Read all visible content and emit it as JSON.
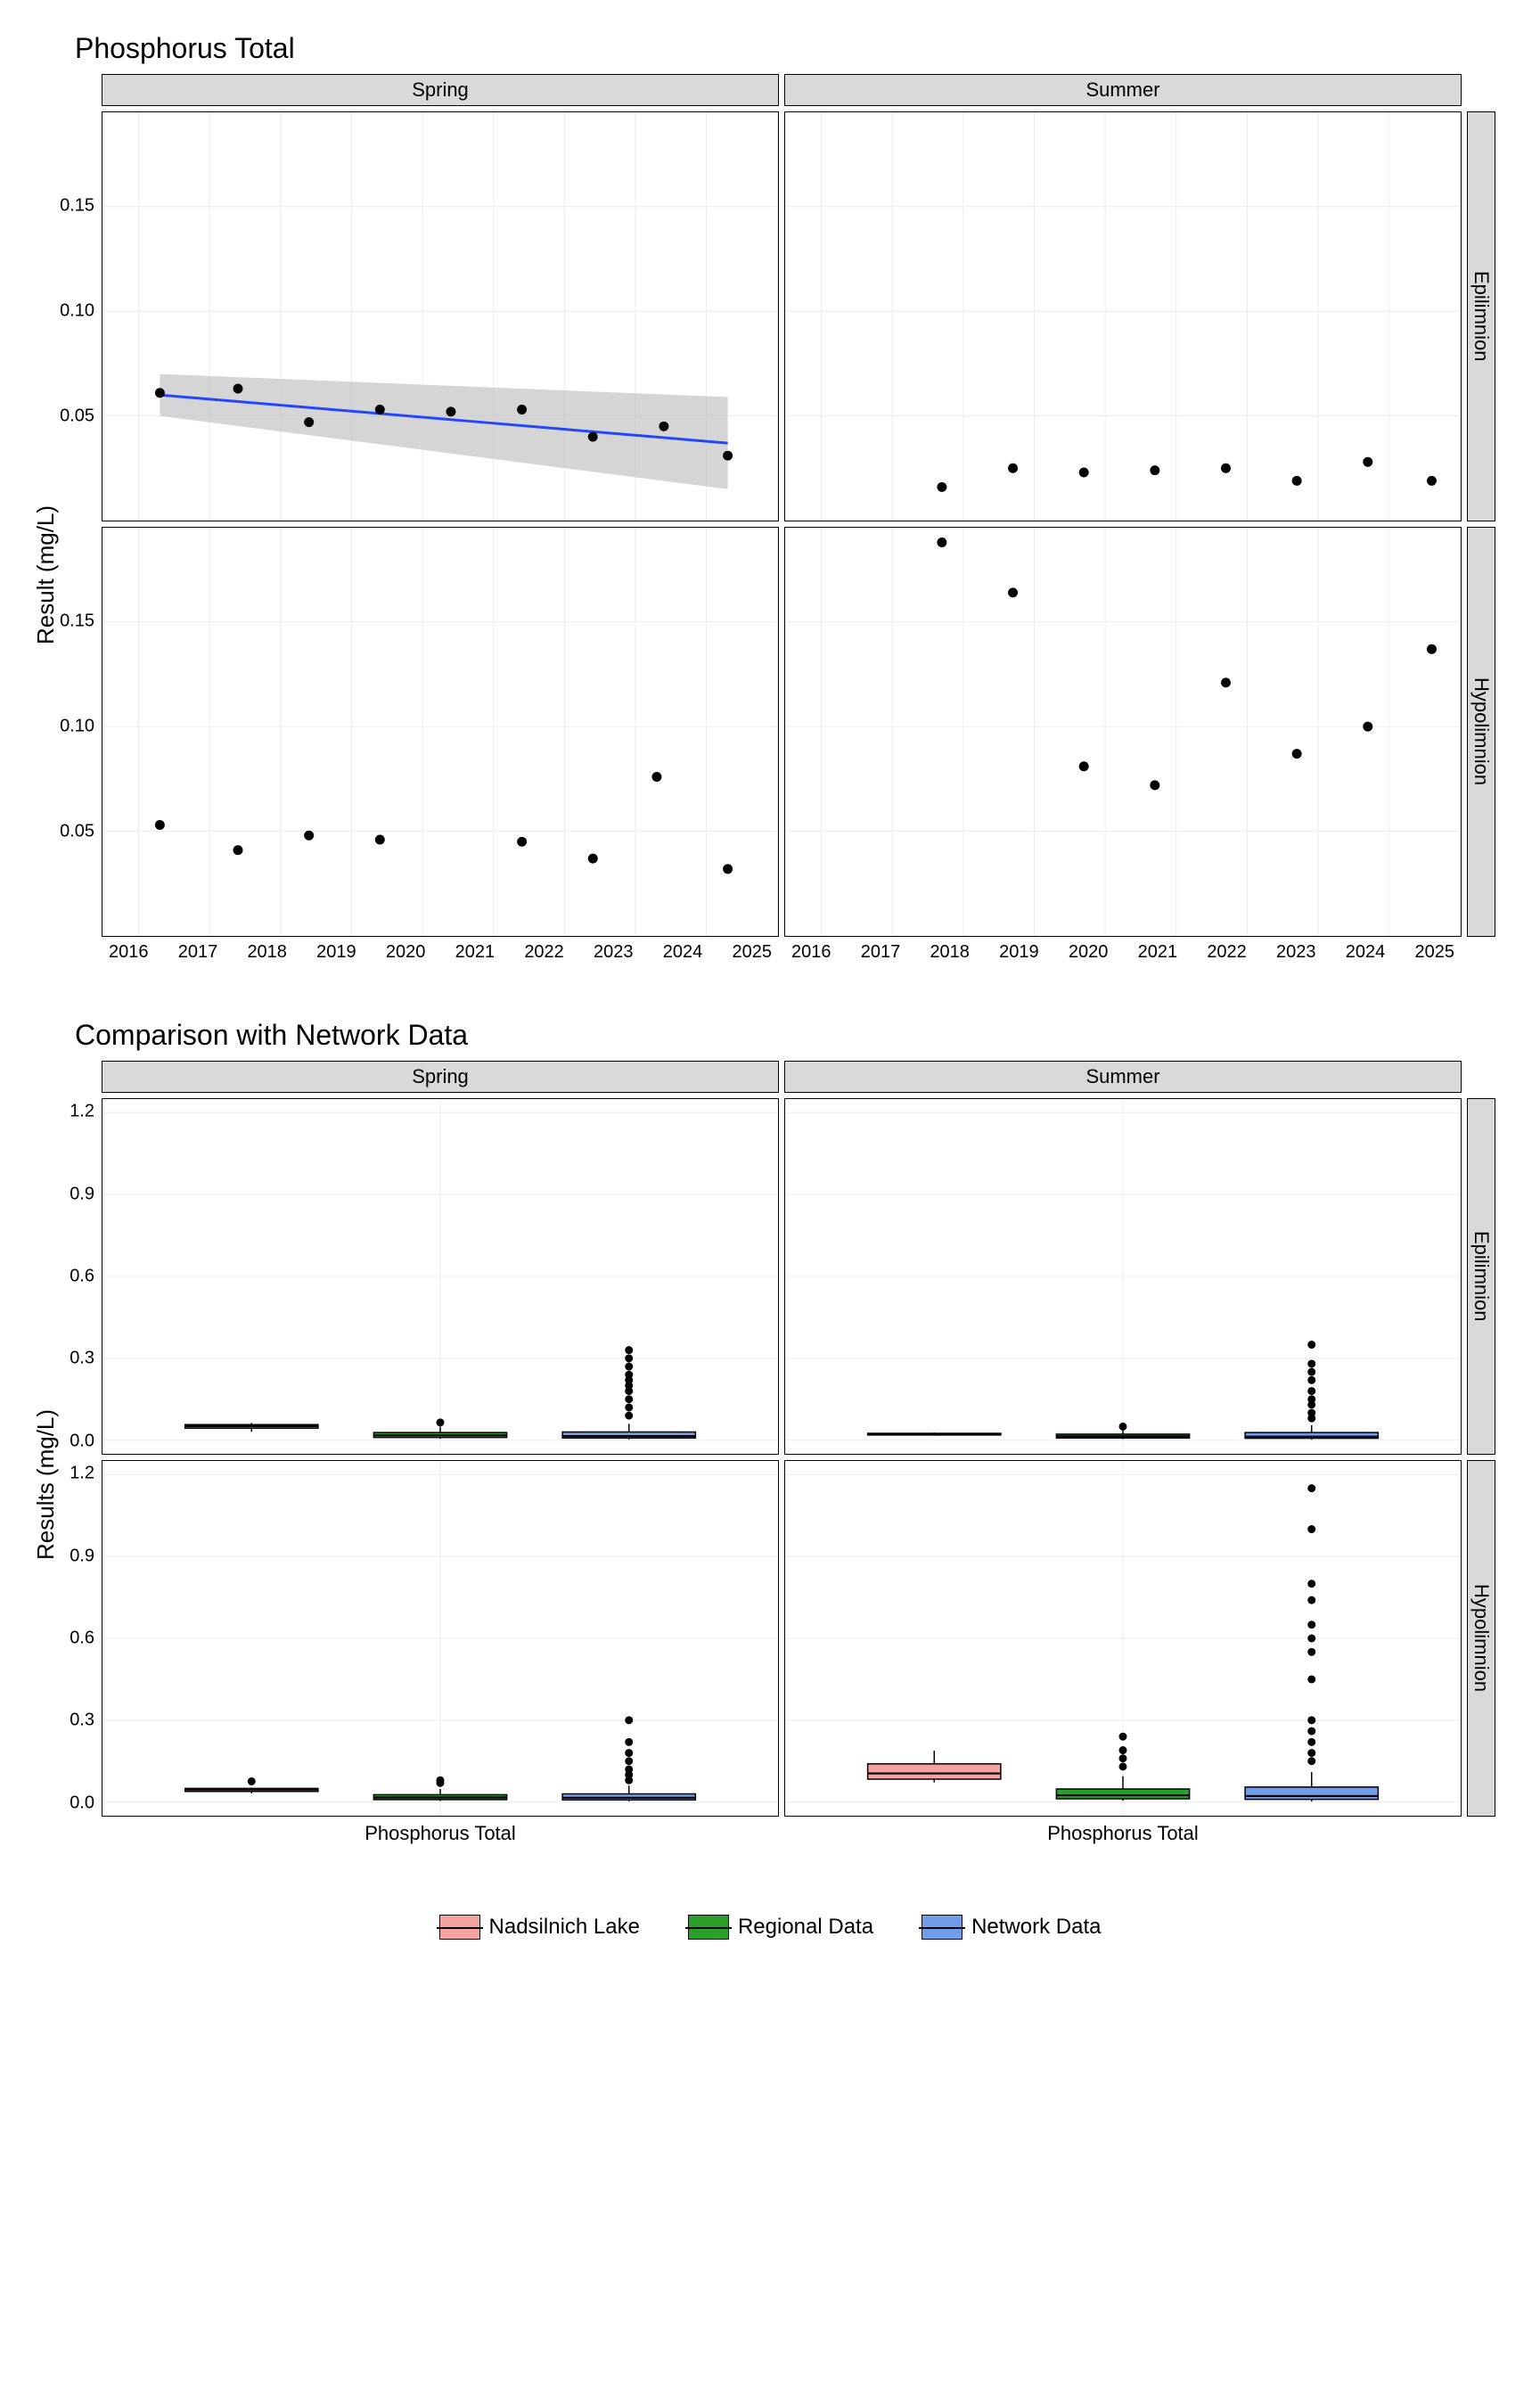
{
  "chart1_title": "Phosphorus Total",
  "chart2_title": "Comparison with Network Data",
  "ylab1": "Result (mg/L)",
  "ylab2": "Results (mg/L)",
  "xlab2": "Phosphorus Total",
  "facets_col": [
    "Spring",
    "Summer"
  ],
  "facets_row": [
    "Epilimnion",
    "Hypolimnion"
  ],
  "legend": [
    {
      "label": "Nadsilnich Lake",
      "color": "#f5a3a0"
    },
    {
      "label": "Regional Data",
      "color": "#2aa02a"
    },
    {
      "label": "Network Data",
      "color": "#6f9de8"
    }
  ],
  "chart_data": [
    {
      "type": "scatter",
      "title": "Phosphorus Total",
      "xlabel": "Year",
      "ylabel": "Result (mg/L)",
      "xlim": [
        2015.5,
        2025
      ],
      "ylim": [
        0,
        0.195
      ],
      "x_ticks": [
        2016,
        2017,
        2018,
        2019,
        2020,
        2021,
        2022,
        2023,
        2024,
        2025
      ],
      "y_ticks": [
        0.05,
        0.1,
        0.15
      ],
      "panels": [
        {
          "col": "Spring",
          "row": "Epilimnion",
          "points": [
            {
              "x": 2016.3,
              "y": 0.061
            },
            {
              "x": 2017.4,
              "y": 0.063
            },
            {
              "x": 2018.4,
              "y": 0.047
            },
            {
              "x": 2019.4,
              "y": 0.053
            },
            {
              "x": 2020.4,
              "y": 0.052
            },
            {
              "x": 2021.4,
              "y": 0.053
            },
            {
              "x": 2022.4,
              "y": 0.04
            },
            {
              "x": 2023.4,
              "y": 0.045
            },
            {
              "x": 2024.3,
              "y": 0.031
            }
          ],
          "trend": {
            "x": [
              2016.3,
              2024.3
            ],
            "y": [
              0.06,
              0.037
            ],
            "ci": 0.01
          }
        },
        {
          "col": "Summer",
          "row": "Epilimnion",
          "points": [
            {
              "x": 2017.7,
              "y": 0.016
            },
            {
              "x": 2018.7,
              "y": 0.025
            },
            {
              "x": 2019.7,
              "y": 0.023
            },
            {
              "x": 2020.7,
              "y": 0.024
            },
            {
              "x": 2021.7,
              "y": 0.025
            },
            {
              "x": 2022.7,
              "y": 0.019
            },
            {
              "x": 2023.7,
              "y": 0.028
            },
            {
              "x": 2024.6,
              "y": 0.019
            }
          ]
        },
        {
          "col": "Spring",
          "row": "Hypolimnion",
          "points": [
            {
              "x": 2016.3,
              "y": 0.053
            },
            {
              "x": 2017.4,
              "y": 0.041
            },
            {
              "x": 2018.4,
              "y": 0.048
            },
            {
              "x": 2019.4,
              "y": 0.046
            },
            {
              "x": 2021.4,
              "y": 0.045
            },
            {
              "x": 2022.4,
              "y": 0.037
            },
            {
              "x": 2023.3,
              "y": 0.076
            },
            {
              "x": 2024.3,
              "y": 0.032
            }
          ]
        },
        {
          "col": "Summer",
          "row": "Hypolimnion",
          "points": [
            {
              "x": 2017.7,
              "y": 0.188
            },
            {
              "x": 2018.7,
              "y": 0.164
            },
            {
              "x": 2019.7,
              "y": 0.081
            },
            {
              "x": 2020.7,
              "y": 0.072
            },
            {
              "x": 2021.7,
              "y": 0.121
            },
            {
              "x": 2022.7,
              "y": 0.087
            },
            {
              "x": 2023.7,
              "y": 0.1
            },
            {
              "x": 2024.6,
              "y": 0.137
            }
          ]
        }
      ]
    },
    {
      "type": "boxplot",
      "title": "Comparison with Network Data",
      "xlabel": "Phosphorus Total",
      "ylabel": "Results (mg/L)",
      "ylim": [
        -0.05,
        1.25
      ],
      "y_ticks": [
        0.0,
        0.3,
        0.6,
        0.9,
        1.2
      ],
      "categories": [
        "Nadsilnich Lake",
        "Regional Data",
        "Network Data"
      ],
      "panels": [
        {
          "col": "Spring",
          "row": "Epilimnion",
          "boxes": [
            {
              "group": "Nadsilnich Lake",
              "min": 0.031,
              "q1": 0.044,
              "median": 0.051,
              "q3": 0.057,
              "max": 0.063,
              "outliers": []
            },
            {
              "group": "Regional Data",
              "min": 0.005,
              "q1": 0.01,
              "median": 0.018,
              "q3": 0.028,
              "max": 0.05,
              "outliers": [
                0.065
              ]
            },
            {
              "group": "Network Data",
              "min": 0.002,
              "q1": 0.008,
              "median": 0.015,
              "q3": 0.03,
              "max": 0.06,
              "outliers": [
                0.09,
                0.12,
                0.15,
                0.18,
                0.2,
                0.22,
                0.24,
                0.27,
                0.3,
                0.33
              ]
            }
          ]
        },
        {
          "col": "Summer",
          "row": "Epilimnion",
          "boxes": [
            {
              "group": "Nadsilnich Lake",
              "min": 0.016,
              "q1": 0.019,
              "median": 0.023,
              "q3": 0.025,
              "max": 0.028,
              "outliers": []
            },
            {
              "group": "Regional Data",
              "min": 0.004,
              "q1": 0.008,
              "median": 0.014,
              "q3": 0.022,
              "max": 0.038,
              "outliers": [
                0.05
              ]
            },
            {
              "group": "Network Data",
              "min": 0.002,
              "q1": 0.007,
              "median": 0.013,
              "q3": 0.028,
              "max": 0.055,
              "outliers": [
                0.08,
                0.1,
                0.13,
                0.15,
                0.18,
                0.22,
                0.25,
                0.28,
                0.35
              ]
            }
          ]
        },
        {
          "col": "Spring",
          "row": "Hypolimnion",
          "boxes": [
            {
              "group": "Nadsilnich Lake",
              "min": 0.032,
              "q1": 0.039,
              "median": 0.046,
              "q3": 0.05,
              "max": 0.053,
              "outliers": [
                0.076
              ]
            },
            {
              "group": "Regional Data",
              "min": 0.004,
              "q1": 0.009,
              "median": 0.017,
              "q3": 0.027,
              "max": 0.048,
              "outliers": [
                0.07,
                0.08
              ]
            },
            {
              "group": "Network Data",
              "min": 0.002,
              "q1": 0.008,
              "median": 0.016,
              "q3": 0.03,
              "max": 0.06,
              "outliers": [
                0.08,
                0.1,
                0.12,
                0.15,
                0.18,
                0.22,
                0.3
              ]
            }
          ]
        },
        {
          "col": "Summer",
          "row": "Hypolimnion",
          "boxes": [
            {
              "group": "Nadsilnich Lake",
              "min": 0.072,
              "q1": 0.084,
              "median": 0.105,
              "q3": 0.14,
              "max": 0.188,
              "outliers": []
            },
            {
              "group": "Regional Data",
              "min": 0.005,
              "q1": 0.012,
              "median": 0.025,
              "q3": 0.048,
              "max": 0.095,
              "outliers": [
                0.13,
                0.16,
                0.19,
                0.24
              ]
            },
            {
              "group": "Network Data",
              "min": 0.002,
              "q1": 0.01,
              "median": 0.022,
              "q3": 0.055,
              "max": 0.11,
              "outliers": [
                0.15,
                0.18,
                0.22,
                0.26,
                0.3,
                0.45,
                0.55,
                0.6,
                0.65,
                0.74,
                0.8,
                1.0,
                1.15
              ]
            }
          ]
        }
      ]
    }
  ]
}
